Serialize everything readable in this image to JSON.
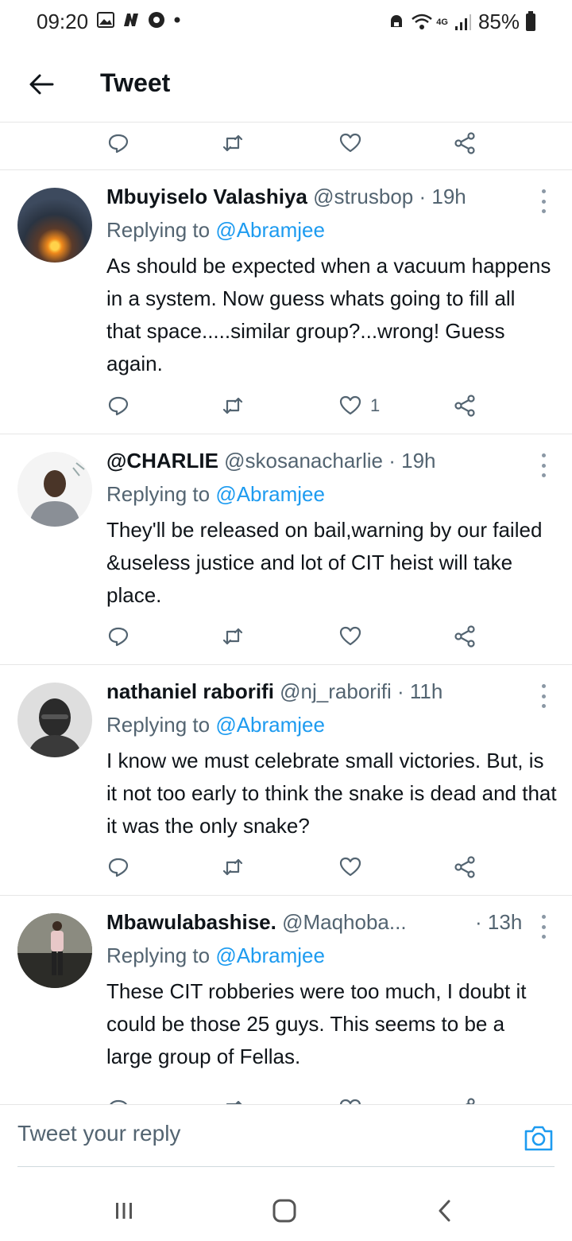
{
  "status_bar": {
    "time": "09:20",
    "network": "4G",
    "battery": "85%"
  },
  "header": {
    "title": "Tweet"
  },
  "tweets": [
    {
      "name": "Mbuyiselo Valashiya",
      "handle": "@strusbop",
      "dot": "·",
      "time": "19h",
      "replying_prefix": "Replying to",
      "replying_to": "@Abramjee",
      "text": "As should be expected when a vacuum happens in a system. Now guess whats going to fill all that space.....similar group?...wrong! Guess again.",
      "likes": "1"
    },
    {
      "name": "@CHARLIE",
      "handle": "@skosanacharlie",
      "dot": "·",
      "time": "19h",
      "replying_prefix": "Replying to",
      "replying_to": "@Abramjee",
      "text": "They'll be released on bail,warning by our failed &useless justice and lot of CIT heist will take place.",
      "likes": ""
    },
    {
      "name": "nathaniel raborifi",
      "handle": "@nj_raborifi",
      "dot": "·",
      "time": "11h",
      "replying_prefix": "Replying to",
      "replying_to": "@Abramjee",
      "text": "I know we must celebrate small victories. But, is it not too early to think the snake is dead and that it was the only snake?",
      "likes": ""
    },
    {
      "name": "Mbawulabashise.",
      "handle": "@Maqhoba...",
      "dot": "·",
      "time": "13h",
      "replying_prefix": "Replying to",
      "replying_to": "@Abramjee",
      "text": "These CIT robberies were too much, I doubt it could be those 25 guys. This seems to be a large group of Fellas.",
      "likes": ""
    }
  ],
  "reply_bar": {
    "placeholder": "Tweet your reply"
  },
  "colors": {
    "accent": "#1d9bf0",
    "secondary_text": "#536471",
    "primary_text": "#0f1419",
    "divider": "#e6e6e6"
  }
}
